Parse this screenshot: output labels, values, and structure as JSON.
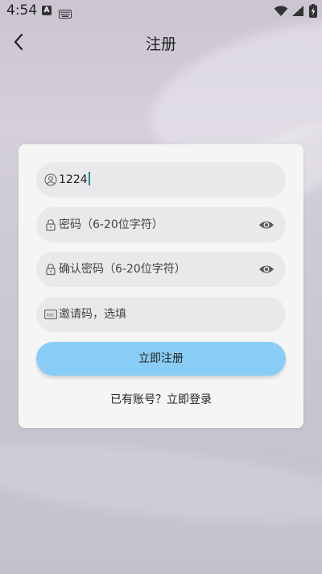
{
  "status_bar": {
    "time": "4:54",
    "a_badge": "A",
    "icons": [
      "keyboard-icon",
      "wifi-icon",
      "signal-icon",
      "battery-icon"
    ]
  },
  "header": {
    "title": "注册",
    "back_icon": "chevron-left-icon"
  },
  "form": {
    "username": {
      "value": "1224",
      "icon": "user-icon"
    },
    "password": {
      "placeholder": "密码（6-20位字符）",
      "icon": "lock-icon",
      "toggle_icon": "eye-icon"
    },
    "confirm_password": {
      "placeholder": "确认密码（6-20位字符）",
      "icon": "lock-icon",
      "toggle_icon": "eye-icon"
    },
    "invite_code": {
      "placeholder": "邀请码，选填",
      "icon": "abc-icon"
    },
    "submit_label": "立即注册",
    "login_link": "已有账号？立即登录"
  },
  "colors": {
    "button": "#89cdf6",
    "caret": "#1e8f8a",
    "field_bg": "#e9e9ec",
    "card_bg": "#f5f5f6"
  }
}
